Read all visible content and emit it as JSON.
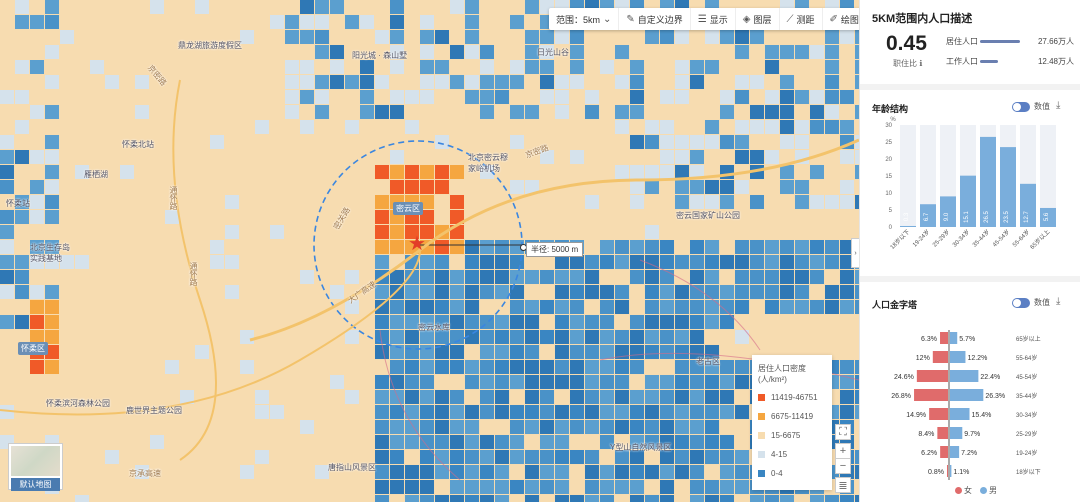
{
  "toolbar": {
    "range_label": "范围：5km",
    "custom_boundary": "自定义边界",
    "display": "显示",
    "layers": "图层",
    "measure": "测距",
    "draw": "绘图"
  },
  "map": {
    "radius_label": "半径: 5000 m",
    "labels": {
      "l1": "鼎龙湖旅游度假区",
      "l2": "阳光城 · 森山墅",
      "l3": "日光山谷",
      "l4": "怀柔北站",
      "l5": "雁栖湖",
      "l6": "怀柔站",
      "l7": "北京生存岛实践基地",
      "l8": "北京密云穆家峪机场",
      "l9": "密云区",
      "l10": "密云国家矿山公园",
      "l11": "怀柔区",
      "l12": "怀柔滨河森林公园",
      "l13": "鹿世界主题公园",
      "l14": "唐指山风景区",
      "l15": "Y型山自然风景区",
      "l16": "老古区",
      "l17": "大广高速",
      "l18": "京密路",
      "l19": "通怀路",
      "l20": "密关路",
      "l21": "京承高速",
      "l22": "京密路",
      "l23": "密云水库",
      "l24": "通怀路"
    },
    "default_map": "默认地图"
  },
  "legend": {
    "title": "居住人口密度(人/km²)",
    "items": [
      {
        "label": "11419-46751",
        "color": "#f05a28"
      },
      {
        "label": "6675-11419",
        "color": "#f5a640"
      },
      {
        "label": "15-6675",
        "color": "#f7dcb0"
      },
      {
        "label": "4-15",
        "color": "#d5e2ec"
      },
      {
        "label": "0-4",
        "color": "#3a86c2"
      }
    ]
  },
  "panel": {
    "title": "5KM范围内人口描述",
    "ratio_value": "0.45",
    "ratio_label": "职住比 ℹ",
    "resident_label": "居住人口",
    "resident_value": "27.66万人",
    "resident_share": 1.0,
    "worker_label": "工作人口",
    "worker_value": "12.48万人",
    "worker_share": 0.45,
    "age_title": "年龄结构",
    "age_toggle": "数值",
    "pyramid_title": "人口金字塔",
    "pyramid_toggle": "数值",
    "female_label": "女",
    "male_label": "男",
    "female_color": "#e06b6b",
    "male_color": "#7aaedc"
  },
  "chart_data": [
    {
      "type": "bar",
      "title": "年龄结构",
      "ylabel": "%",
      "ylim": [
        0,
        30
      ],
      "categories": [
        "18岁以下",
        "19-24岁",
        "25-29岁",
        "30-34岁",
        "35-44岁",
        "45-54岁",
        "55-64岁",
        "65岁以上"
      ],
      "values": [
        0.3,
        6.7,
        9.0,
        15.1,
        26.5,
        23.5,
        12.7,
        5.6
      ],
      "labels": [
        "0.3",
        "6.7",
        "9.0",
        "15.1",
        "26.5",
        "23.5",
        "12.7",
        "5.6"
      ]
    },
    {
      "type": "bar",
      "title": "人口金字塔",
      "categories": [
        "65岁以上",
        "55-64岁",
        "45-54岁",
        "35-44岁",
        "30-34岁",
        "25-29岁",
        "19-24岁",
        "18岁以下"
      ],
      "series": [
        {
          "name": "女",
          "values": [
            6.3,
            12,
            24.6,
            26.8,
            14.9,
            8.4,
            6.2,
            0.8
          ],
          "labels": [
            "6.3%",
            "12%",
            "24.6%",
            "26.8%",
            "14.9%",
            "8.4%",
            "6.2%",
            "0.8%"
          ]
        },
        {
          "name": "男",
          "values": [
            5.7,
            12.2,
            22.4,
            26.3,
            15.4,
            9.7,
            7.2,
            1.1
          ],
          "labels": [
            "5.7%",
            "12.2%",
            "22.4%",
            "26.3%",
            "15.4%",
            "9.7%",
            "7.2%",
            "1.1%"
          ]
        }
      ]
    }
  ]
}
